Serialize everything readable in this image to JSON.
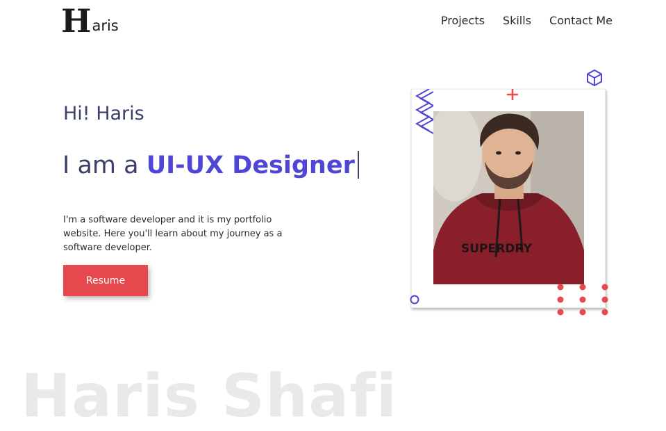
{
  "header": {
    "logo_initial": "H",
    "logo_rest": "aris",
    "nav": [
      {
        "label": "Projects"
      },
      {
        "label": "Skills"
      },
      {
        "label": "Contact Me"
      }
    ]
  },
  "hero": {
    "greeting": "Hi! Haris",
    "headline_prefix": "I am a ",
    "headline_role": "UI-UX Designer",
    "bio": "I'm a software developer and it is my portfolio website. Here you'll learn about my journey as a software developer.",
    "resume_label": "Resume"
  },
  "photo": {
    "shirt_text": "SUPERDRY"
  },
  "footer": {
    "watermark": "Haris Shafi"
  },
  "colors": {
    "accent": "#5046d6",
    "button": "#e5484d",
    "heading": "#3a4068",
    "dots": "#e5484d",
    "deco": "#5046d6"
  }
}
